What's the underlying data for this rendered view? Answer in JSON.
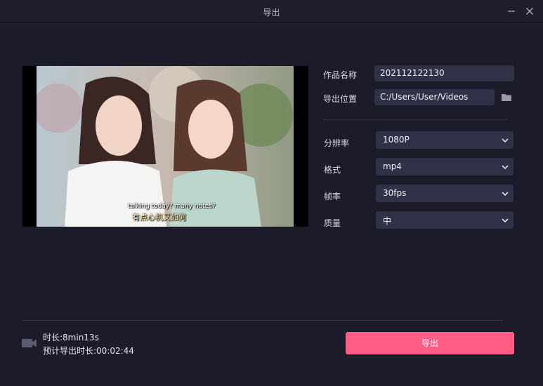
{
  "window": {
    "title": "导出"
  },
  "preview": {
    "subtitle_en": "talking today? many notes?",
    "subtitle_zh": "有点心机又如何"
  },
  "form": {
    "name_label": "作品名称",
    "name_value": "202112122130",
    "location_label": "导出位置",
    "location_value": "C:/Users/User/Videos",
    "resolution_label": "分辨率",
    "resolution_value": "1080P",
    "format_label": "格式",
    "format_value": "mp4",
    "framerate_label": "帧率",
    "framerate_value": "30fps",
    "quality_label": "质量",
    "quality_value": "中"
  },
  "footer": {
    "duration": "时长:8min13s",
    "estimated": "预计导出时长:00:02:44",
    "export_label": "导出"
  },
  "colors": {
    "background": "#1b1b29",
    "field": "#303046",
    "accent": "#ff5c86"
  },
  "icons": [
    "minimize-icon",
    "close-icon",
    "folder-icon",
    "chevron-down-icon",
    "video-camera-icon"
  ]
}
